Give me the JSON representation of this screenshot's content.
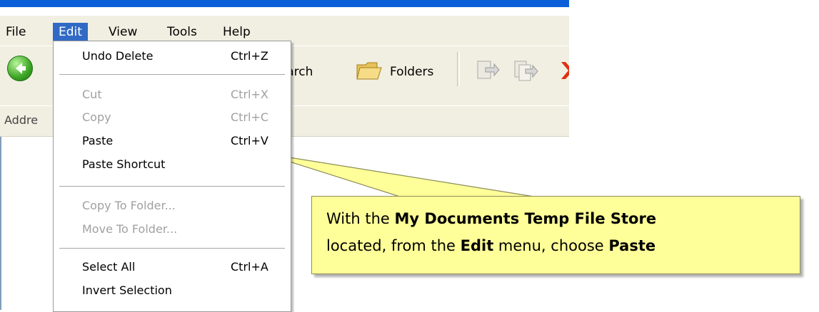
{
  "menubar": {
    "items": [
      "File",
      "Edit",
      "View",
      "Tools",
      "Help"
    ],
    "active": "Edit"
  },
  "toolbar": {
    "search_label": "Search",
    "folders_label": "Folders"
  },
  "addressbar": {
    "label": "Addre"
  },
  "edit_menu": {
    "items": [
      {
        "label": "Undo Delete",
        "shortcut": "Ctrl+Z",
        "enabled": true
      },
      {
        "label": "Cut",
        "shortcut": "Ctrl+X",
        "enabled": false
      },
      {
        "label": "Copy",
        "shortcut": "Ctrl+C",
        "enabled": false
      },
      {
        "label": "Paste",
        "shortcut": "Ctrl+V",
        "enabled": true
      },
      {
        "label": "Paste Shortcut",
        "shortcut": "",
        "enabled": true
      },
      {
        "label": "Copy To Folder...",
        "shortcut": "",
        "enabled": false
      },
      {
        "label": "Move To Folder...",
        "shortcut": "",
        "enabled": false
      },
      {
        "label": "Select All",
        "shortcut": "Ctrl+A",
        "enabled": true
      },
      {
        "label": "Invert Selection",
        "shortcut": "",
        "enabled": true
      }
    ]
  },
  "callout": {
    "t1": "With the ",
    "b1": "My Documents Temp File Store",
    "t2": "located, from the ",
    "b2": "Edit",
    "t3": " menu, choose ",
    "b3": "Paste"
  },
  "colors": {
    "title_bar": "#0a5fd8",
    "chrome": "#f1efe2",
    "menu_highlight": "#316ac5",
    "callout_fill": "#ffff99",
    "disabled_text": "#a0a0a0"
  },
  "icons": [
    "back-arrow-icon",
    "folders-icon",
    "move-to-icon",
    "copy-to-icon",
    "delete-icon"
  ]
}
